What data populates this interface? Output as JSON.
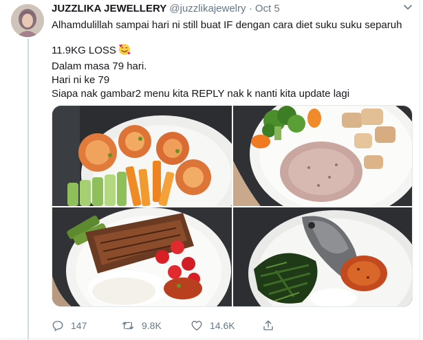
{
  "tweet": {
    "author_name": "JUZZLIKA JEWELLERY",
    "handle": "@juzzlikajewelry",
    "separator": "·",
    "date": "Oct 5",
    "lines": [
      "Alhamdulillah sampai hari ni still buat IF dengan cara diet suku suku separuh",
      "11.9KG LOSS",
      "Dalam masa 79 hari.",
      "Hari ni ke 79",
      "Siapa nak gambar2 menu kita REPLY nak k nanti kita update lagi"
    ],
    "emoji_icon": "smiling-face-with-hearts-icon"
  },
  "actions": {
    "replies": "147",
    "retweets": "9.8K",
    "likes": "14.6K"
  },
  "colors": {
    "text": "#14171a",
    "muted": "#657786",
    "border": "#e6ecf0"
  },
  "icons": [
    "more-icon",
    "reply-icon",
    "retweet-icon",
    "like-icon",
    "share-icon"
  ]
}
